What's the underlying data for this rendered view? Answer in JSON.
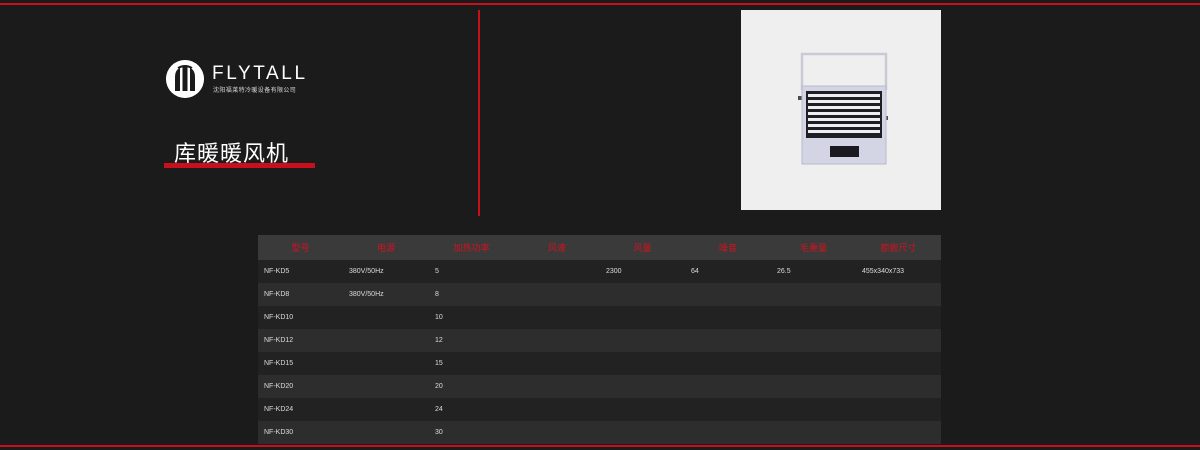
{
  "brand": {
    "name": "FLYTALL",
    "subtitle": "沈阳福莱特冷暖设备有限公司"
  },
  "product": {
    "title": "库暖暖风机"
  },
  "specs": {
    "headers": [
      "型号",
      "电源",
      "加热功率",
      "风速",
      "风量",
      "噪音",
      "毛重量",
      "额嵌尺寸"
    ],
    "rows": [
      [
        "NF-KD5",
        "380V/50Hz",
        "5",
        "",
        "2300",
        "64",
        "26.5",
        "455x340x733"
      ],
      [
        "NF-KD8",
        "380V/50Hz",
        "8",
        "",
        "",
        "",
        "",
        ""
      ],
      [
        "NF-KD10",
        "",
        "10",
        "",
        "",
        "",
        "",
        ""
      ],
      [
        "NF-KD12",
        "",
        "12",
        "",
        "",
        "",
        "",
        ""
      ],
      [
        "NF-KD15",
        "",
        "15",
        "",
        "",
        "",
        "",
        ""
      ],
      [
        "NF-KD20",
        "",
        "20",
        "",
        "",
        "",
        "",
        ""
      ],
      [
        "NF-KD24",
        "",
        "24",
        "",
        "",
        "",
        "",
        ""
      ],
      [
        "NF-KD30",
        "",
        "30",
        "",
        "",
        "",
        "",
        ""
      ]
    ]
  },
  "colors": {
    "accent": "#c8101d",
    "background": "#1c1b1c",
    "header_row": "#3b3a3b"
  }
}
